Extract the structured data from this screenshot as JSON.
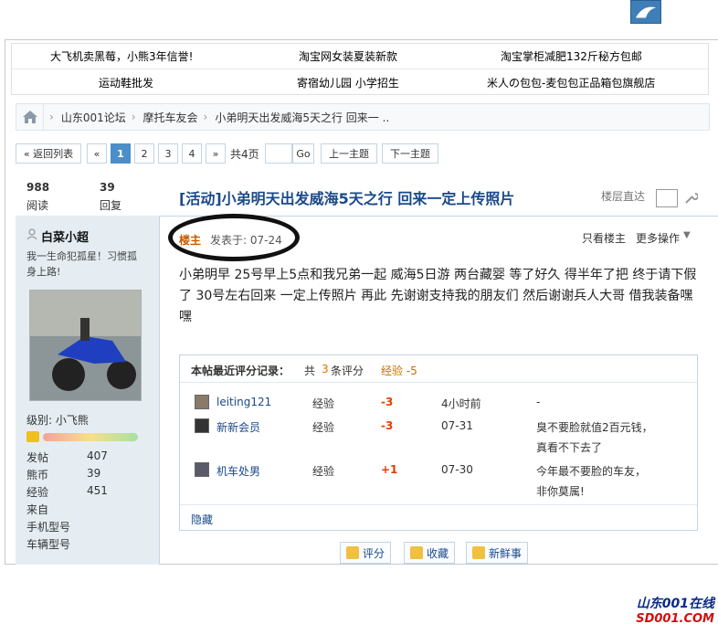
{
  "ads": {
    "row1": [
      "大飞机卖黑莓，小熊3年信誉!",
      "淘宝网女装夏装新款",
      "淘宝掌柜减肥132斤秘方包邮"
    ],
    "row2": [
      "运动鞋批发",
      "寄宿幼儿园 小学招生",
      "米人の包包-麦包包正品箱包旗舰店"
    ]
  },
  "breadcrumb": [
    "山东001论坛",
    "摩托车友会",
    "小弟明天出发威海5天之行 回来一 .."
  ],
  "pager": {
    "back": "« 返回列表",
    "prev": "«",
    "pages": [
      "1",
      "2",
      "3",
      "4"
    ],
    "next": "»",
    "total": "共4页",
    "go": "Go",
    "prev_topic": "上一主题",
    "next_topic": "下一主题"
  },
  "stats": {
    "views": "988",
    "views_label": "阅读",
    "replies": "39",
    "replies_label": "回复"
  },
  "thread": {
    "title": "[活动]小弟明天出发威海5天之行 回来一定上传照片",
    "floor_jump": "楼层直达"
  },
  "author": {
    "name": "白菜小超",
    "signature": "我一生命犯孤星！习惯孤身上路!",
    "level": "级别: 小飞熊",
    "fields": [
      {
        "k": "发帖",
        "v": "407"
      },
      {
        "k": "熊币",
        "v": "39"
      },
      {
        "k": "经验",
        "v": "451"
      },
      {
        "k": "来自",
        "v": ""
      },
      {
        "k": "手机型号",
        "v": ""
      },
      {
        "k": "车辆型号",
        "v": ""
      }
    ]
  },
  "post": {
    "owner": "楼主",
    "date": "发表于: 07-24",
    "only_owner": "只看楼主",
    "more": "更多操作",
    "body": "小弟明早 25号早上5点和我兄弟一起 威海5日游 两台藏婴 等了好久 得半年了把 终于请下假了 30号左右回来 一定上传照片 再此 先谢谢支持我的朋友们 然后谢谢兵人大哥 借我装备嘿嘿"
  },
  "rating": {
    "header": "本帖最近评分记录：",
    "count_prefix": "共",
    "count": "3",
    "count_suffix": "条评分",
    "exp": "经验 -5",
    "rows": [
      {
        "user": "leiting121",
        "type": "经验",
        "score": "-3",
        "time": "4小时前",
        "reason": "-"
      },
      {
        "user": "新新会员",
        "type": "经验",
        "score": "-3",
        "time": "07-31",
        "reason": "臭不要脸就值2百元钱，真看不下去了"
      },
      {
        "user": "机车处男",
        "type": "经验",
        "score": "+1",
        "time": "07-30",
        "reason": "今年最不要脸的车友，非你莫属!"
      }
    ],
    "hide": "隐藏"
  },
  "actions": [
    "评分",
    "收藏",
    "新鲜事"
  ],
  "watermark": {
    "line1": "山东001在线",
    "line2": "SD001.COM"
  }
}
